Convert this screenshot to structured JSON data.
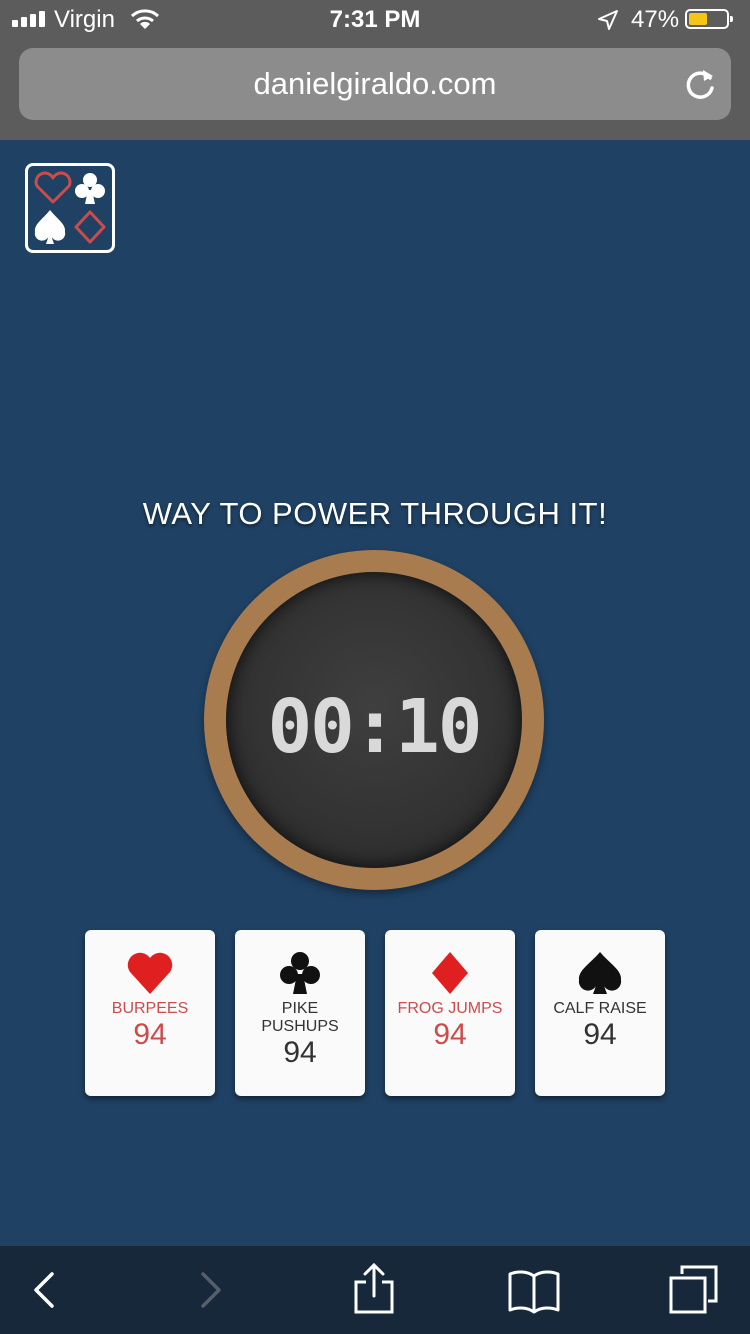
{
  "status_bar": {
    "carrier": "Virgin",
    "time": "7:31 PM",
    "battery_percent": "47%",
    "battery_level": 0.47,
    "icons": [
      "signal-icon",
      "wifi-icon",
      "location-arrow-icon",
      "battery-icon"
    ]
  },
  "browser": {
    "url": "danielgiraldo.com",
    "reload_icon": "reload-icon",
    "toolbar_icons": [
      "back-icon",
      "forward-icon",
      "share-icon",
      "bookmarks-icon",
      "tabs-icon"
    ]
  },
  "logo": {
    "icon": "card-suits-logo",
    "colors": {
      "heart": "#cc4c4c",
      "diamond": "#cc4c4c",
      "club": "#ffffff",
      "spade": "#ffffff"
    }
  },
  "message": "WAY TO POWER THROUGH IT!",
  "timer": {
    "display": "00:10",
    "ring_color": "#a87c4f"
  },
  "exercises": [
    {
      "suit": "heart",
      "icon": "heart-icon",
      "label": "BURPEES",
      "count": "94",
      "color": "#cc4c4c"
    },
    {
      "suit": "club",
      "icon": "club-icon",
      "label": "PIKE PUSHUPS",
      "count": "94",
      "color": "#333333"
    },
    {
      "suit": "diamond",
      "icon": "diamond-icon",
      "label": "FROG JUMPS",
      "count": "94",
      "color": "#cc4c4c"
    },
    {
      "suit": "spade",
      "icon": "spade-icon",
      "label": "CALF RAISE",
      "count": "94",
      "color": "#333333"
    }
  ],
  "colors": {
    "background": "#1f4163",
    "accent_red": "#cc4c4c",
    "browser_chrome": "#5c5c5c",
    "toolbar": "#16283a"
  }
}
